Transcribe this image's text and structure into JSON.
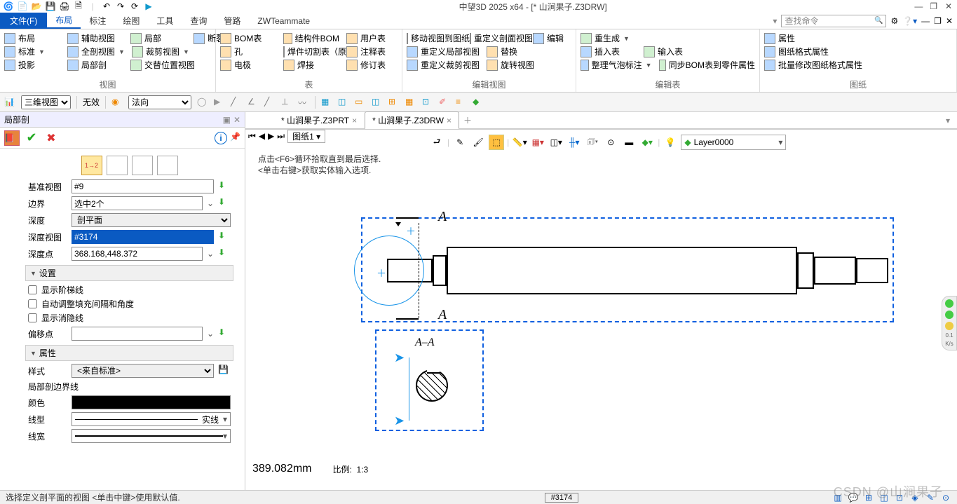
{
  "app": {
    "title": "中望3D 2025 x64 - [* 山涧果子.Z3DRW]"
  },
  "menu": {
    "file": "文件(F)",
    "items": [
      "布局",
      "标注",
      "绘图",
      "工具",
      "查询",
      "管路",
      "ZWTeammate"
    ],
    "search_placeholder": "查找命令"
  },
  "ribbon": {
    "group1": {
      "label": "视图",
      "r1": [
        "布局",
        "辅助视图",
        "局部",
        "断裂"
      ],
      "r2": [
        "标准",
        "全剖视图",
        "裁剪视图"
      ],
      "r3": [
        "投影",
        "局部剖",
        "交替位置视图"
      ]
    },
    "group2": {
      "label": "表",
      "r1": [
        "BOM表",
        "结构件BOM",
        "用户表"
      ],
      "r2": [
        "孔",
        "焊件切割表（原）",
        "注释表"
      ],
      "r3": [
        "电极",
        "焊接",
        "修订表"
      ]
    },
    "group3": {
      "label": "编辑视图",
      "r1": [
        "移动视图到图纸",
        "重定义剖面视图",
        "编辑"
      ],
      "r2": [
        "重定义局部视图",
        "替换"
      ],
      "r3": [
        "重定义裁剪视图",
        "旋转视图"
      ]
    },
    "group4": {
      "label": "编辑表",
      "r1": [
        "重生成"
      ],
      "r2": [
        "插入表",
        "输入表"
      ],
      "r3": [
        "整理气泡标注",
        "同步BOM表到零件属性"
      ]
    },
    "group5": {
      "label": "图纸",
      "r1": [
        "属性"
      ],
      "r2": [
        "图纸格式属性"
      ],
      "r3": [
        "批量修改图纸格式属性"
      ]
    }
  },
  "toolbar2": {
    "view_select": "三维视图",
    "status": "无效",
    "direction": "法向"
  },
  "panel": {
    "title": "局部剖",
    "fields": {
      "base_view_label": "基准视图",
      "base_view_value": "#9",
      "boundary_label": "边界",
      "boundary_value": "选中2个",
      "depth_label": "深度",
      "depth_value": "剖平面",
      "depth_view_label": "深度视图",
      "depth_view_value": "#3174",
      "depth_point_label": "深度点",
      "depth_point_value": "368.168,448.372"
    },
    "settings": {
      "header": "设置",
      "chk1": "显示阶梯线",
      "chk2": "自动调整填充间隔和角度",
      "chk3": "显示消隐线",
      "offset_label": "偏移点"
    },
    "attrs": {
      "header": "属性",
      "style_label": "样式",
      "style_value": "<来自标准>",
      "boundary_line": "局部剖边界线",
      "color_label": "颜色",
      "linetype_label": "线型",
      "linetype_value": "实线",
      "lineweight_label": "线宽"
    }
  },
  "tabs": {
    "t1": "* 山涧果子.Z3PRT",
    "t2": "* 山涧果子.Z3DRW"
  },
  "viewbar": {
    "layer": "Layer0000"
  },
  "hint": {
    "l1": "点击<F6>循环拾取直到最后选择.",
    "l2": "<单击右键>获取实体输入选项."
  },
  "drawing": {
    "section_letter": "A",
    "section_label": "A–A"
  },
  "status_info": {
    "dim": "389.082mm",
    "scale_label": "比例:",
    "scale_value": "1:3"
  },
  "sheet": {
    "name": "图纸1"
  },
  "status": {
    "msg": "选择定义剖平面的视图  <单击中键>使用默认值.",
    "tag": "#3174"
  },
  "float": {
    "speed": "0.1",
    "unit": "K/s"
  },
  "watermark": "CSDN @山涧果子"
}
